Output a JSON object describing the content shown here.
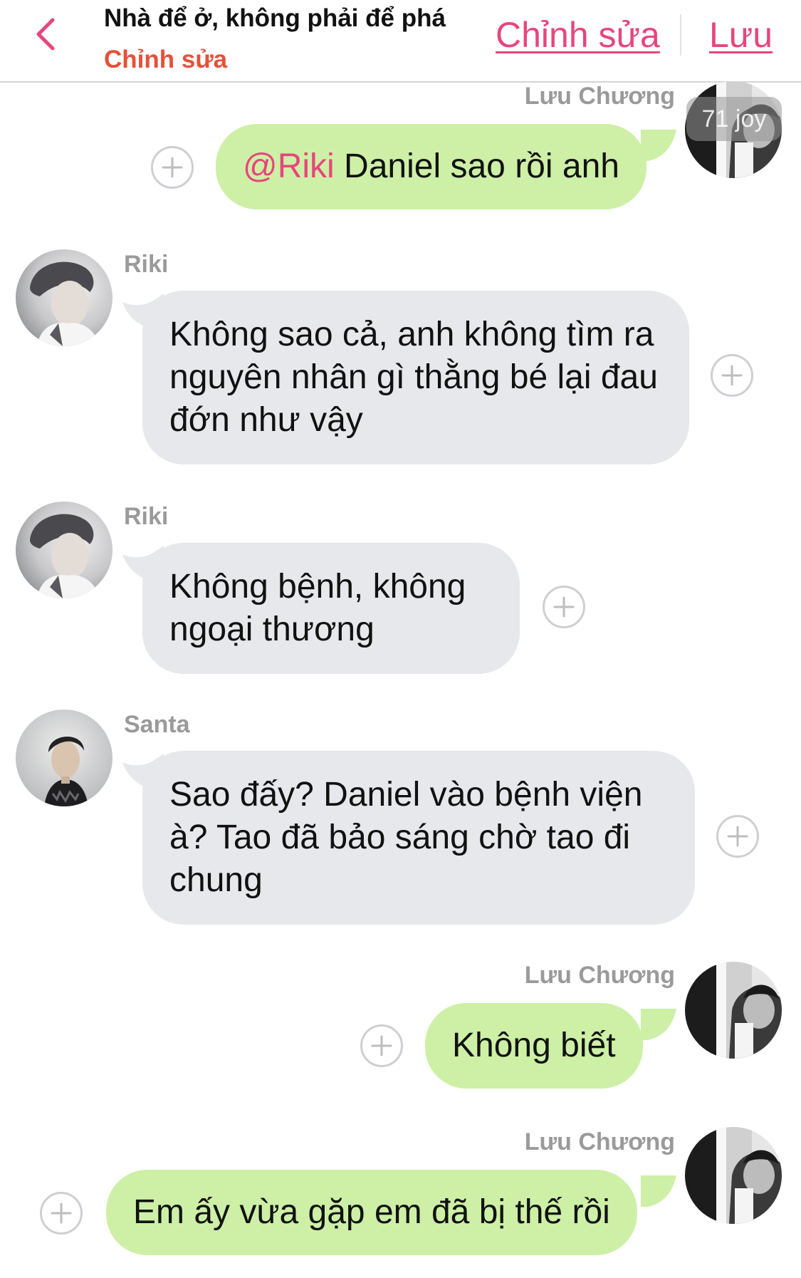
{
  "header": {
    "title": "Nhà để ở, không phải để phá",
    "subtitle": "Chỉnh sửa",
    "edit_label": "Chỉnh sửa",
    "save_label": "Lưu"
  },
  "colors": {
    "accent": "#e8457d",
    "subtitle": "#e6503a",
    "outgoing_bubble": "#cdf0a6",
    "incoming_bubble": "#e7e8eb",
    "sender_name": "#9a9a9a"
  },
  "messages": [
    {
      "direction": "outgoing",
      "sender": "Lưu Chương",
      "mention": "@Riki",
      "text": " Daniel sao rồi anh",
      "avatar_badge": "71 joy"
    },
    {
      "direction": "incoming",
      "sender": "Riki",
      "text": "Không sao cả, anh không tìm ra nguyên nhân gì thằng bé lại đau đớn như vậy"
    },
    {
      "direction": "incoming",
      "sender": "Riki",
      "text": "Không bệnh, không ngoại thương"
    },
    {
      "direction": "incoming",
      "sender": "Santa",
      "text": "Sao đấy? Daniel vào bệnh viện à? Tao đã bảo sáng chờ tao đi chung"
    },
    {
      "direction": "outgoing",
      "sender": "Lưu Chương",
      "text": "Không biết"
    },
    {
      "direction": "outgoing",
      "sender": "Lưu Chương",
      "text": "Em ấy vừa gặp em đã bị thế rồi"
    }
  ]
}
